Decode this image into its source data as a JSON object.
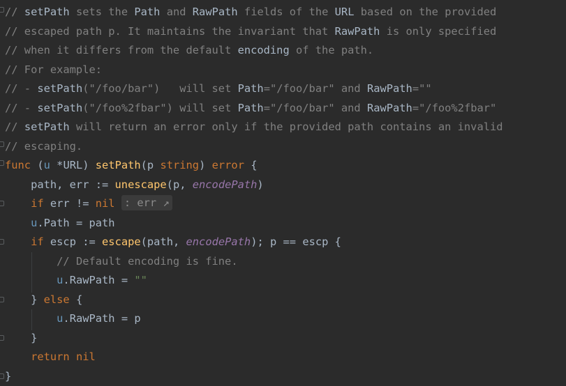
{
  "editor": {
    "lines": [
      {
        "tokens": [
          {
            "cls": "tok-comment",
            "text": "// "
          },
          {
            "cls": "tok-comment-ref",
            "text": "setPath"
          },
          {
            "cls": "tok-comment",
            "text": " sets the "
          },
          {
            "cls": "tok-comment-ref",
            "text": "Path"
          },
          {
            "cls": "tok-comment",
            "text": " and "
          },
          {
            "cls": "tok-comment-ref",
            "text": "RawPath"
          },
          {
            "cls": "tok-comment",
            "text": " fields of the "
          },
          {
            "cls": "tok-comment-ref",
            "text": "URL"
          },
          {
            "cls": "tok-comment",
            "text": " based on the provided"
          }
        ]
      },
      {
        "tokens": [
          {
            "cls": "tok-comment",
            "text": "// escaped path p. It maintains the invariant that "
          },
          {
            "cls": "tok-comment-ref",
            "text": "RawPath"
          },
          {
            "cls": "tok-comment",
            "text": " is only specified"
          }
        ]
      },
      {
        "tokens": [
          {
            "cls": "tok-comment",
            "text": "// when it differs from the default "
          },
          {
            "cls": "tok-comment-ref",
            "text": "encoding"
          },
          {
            "cls": "tok-comment",
            "text": " of the path."
          }
        ]
      },
      {
        "tokens": [
          {
            "cls": "tok-comment",
            "text": "// For example:"
          }
        ]
      },
      {
        "tokens": [
          {
            "cls": "tok-comment",
            "text": "// - "
          },
          {
            "cls": "tok-comment-ref",
            "text": "setPath"
          },
          {
            "cls": "tok-comment",
            "text": "(\"/foo/bar\")   will set "
          },
          {
            "cls": "tok-comment-ref",
            "text": "Path"
          },
          {
            "cls": "tok-comment",
            "text": "=\"/foo/bar\" and "
          },
          {
            "cls": "tok-comment-ref",
            "text": "RawPath"
          },
          {
            "cls": "tok-comment",
            "text": "=\"\""
          }
        ]
      },
      {
        "tokens": [
          {
            "cls": "tok-comment",
            "text": "// - "
          },
          {
            "cls": "tok-comment-ref",
            "text": "setPath"
          },
          {
            "cls": "tok-comment",
            "text": "(\"/foo%2fbar\") will set "
          },
          {
            "cls": "tok-comment-ref",
            "text": "Path"
          },
          {
            "cls": "tok-comment",
            "text": "=\"/foo/bar\" and "
          },
          {
            "cls": "tok-comment-ref",
            "text": "RawPath"
          },
          {
            "cls": "tok-comment",
            "text": "=\"/foo%2fbar\""
          }
        ]
      },
      {
        "tokens": [
          {
            "cls": "tok-comment",
            "text": "// "
          },
          {
            "cls": "tok-comment-ref",
            "text": "setPath"
          },
          {
            "cls": "tok-comment",
            "text": " will return an error only if the provided path contains an invalid"
          }
        ]
      },
      {
        "tokens": [
          {
            "cls": "tok-comment",
            "text": "// escaping."
          }
        ]
      },
      {
        "tokens": [
          {
            "cls": "tok-keyword",
            "text": "func"
          },
          {
            "cls": "tok-ident",
            "text": " ("
          },
          {
            "cls": "tok-recv",
            "text": "u"
          },
          {
            "cls": "tok-ident",
            "text": " *URL) "
          },
          {
            "cls": "tok-func",
            "text": "setPath"
          },
          {
            "cls": "tok-ident",
            "text": "(p "
          },
          {
            "cls": "tok-type2",
            "text": "string"
          },
          {
            "cls": "tok-ident",
            "text": ") "
          },
          {
            "cls": "tok-type2",
            "text": "error"
          },
          {
            "cls": "tok-ident",
            "text": " {"
          }
        ]
      },
      {
        "tokens": [
          {
            "cls": "tok-ident",
            "text": "    path, err := "
          },
          {
            "cls": "tok-func",
            "text": "unescape"
          },
          {
            "cls": "tok-ident",
            "text": "(p, "
          },
          {
            "cls": "tok-param",
            "text": "encodePath"
          },
          {
            "cls": "tok-ident",
            "text": ")"
          }
        ]
      },
      {
        "tokens": [
          {
            "cls": "tok-ident",
            "text": "    "
          },
          {
            "cls": "tok-keyword",
            "text": "if"
          },
          {
            "cls": "tok-ident",
            "text": " err != "
          },
          {
            "cls": "tok-keyword",
            "text": "nil"
          },
          {
            "cls": "tok-ident",
            "text": " "
          },
          {
            "cls": "inlay",
            "text": ": err ↗"
          }
        ]
      },
      {
        "tokens": [
          {
            "cls": "tok-ident",
            "text": "    "
          },
          {
            "cls": "tok-recv",
            "text": "u"
          },
          {
            "cls": "tok-ident",
            "text": ".Path = path"
          }
        ]
      },
      {
        "tokens": [
          {
            "cls": "tok-ident",
            "text": "    "
          },
          {
            "cls": "tok-keyword",
            "text": "if"
          },
          {
            "cls": "tok-ident",
            "text": " escp := "
          },
          {
            "cls": "tok-func",
            "text": "escape"
          },
          {
            "cls": "tok-ident",
            "text": "(path, "
          },
          {
            "cls": "tok-param",
            "text": "encodePath"
          },
          {
            "cls": "tok-ident",
            "text": "); p == escp {"
          }
        ]
      },
      {
        "tokens": [
          {
            "cls": "tok-ident",
            "text": "        "
          },
          {
            "cls": "tok-comment",
            "text": "// Default encoding is fine."
          }
        ]
      },
      {
        "tokens": [
          {
            "cls": "tok-ident",
            "text": "        "
          },
          {
            "cls": "tok-recv",
            "text": "u"
          },
          {
            "cls": "tok-ident",
            "text": ".RawPath = "
          },
          {
            "cls": "tok-string",
            "text": "\"\""
          }
        ]
      },
      {
        "tokens": [
          {
            "cls": "tok-ident",
            "text": "    } "
          },
          {
            "cls": "tok-keyword",
            "text": "else"
          },
          {
            "cls": "tok-ident",
            "text": " {"
          }
        ]
      },
      {
        "tokens": [
          {
            "cls": "tok-ident",
            "text": "        "
          },
          {
            "cls": "tok-recv",
            "text": "u"
          },
          {
            "cls": "tok-ident",
            "text": ".RawPath = p"
          }
        ]
      },
      {
        "tokens": [
          {
            "cls": "tok-ident",
            "text": "    }"
          }
        ]
      },
      {
        "tokens": [
          {
            "cls": "tok-ident",
            "text": "    "
          },
          {
            "cls": "tok-keyword",
            "text": "return"
          },
          {
            "cls": "tok-ident",
            "text": " "
          },
          {
            "cls": "tok-keyword",
            "text": "nil"
          }
        ]
      },
      {
        "tokens": [
          {
            "cls": "tok-ident",
            "text": "}"
          }
        ]
      }
    ]
  }
}
